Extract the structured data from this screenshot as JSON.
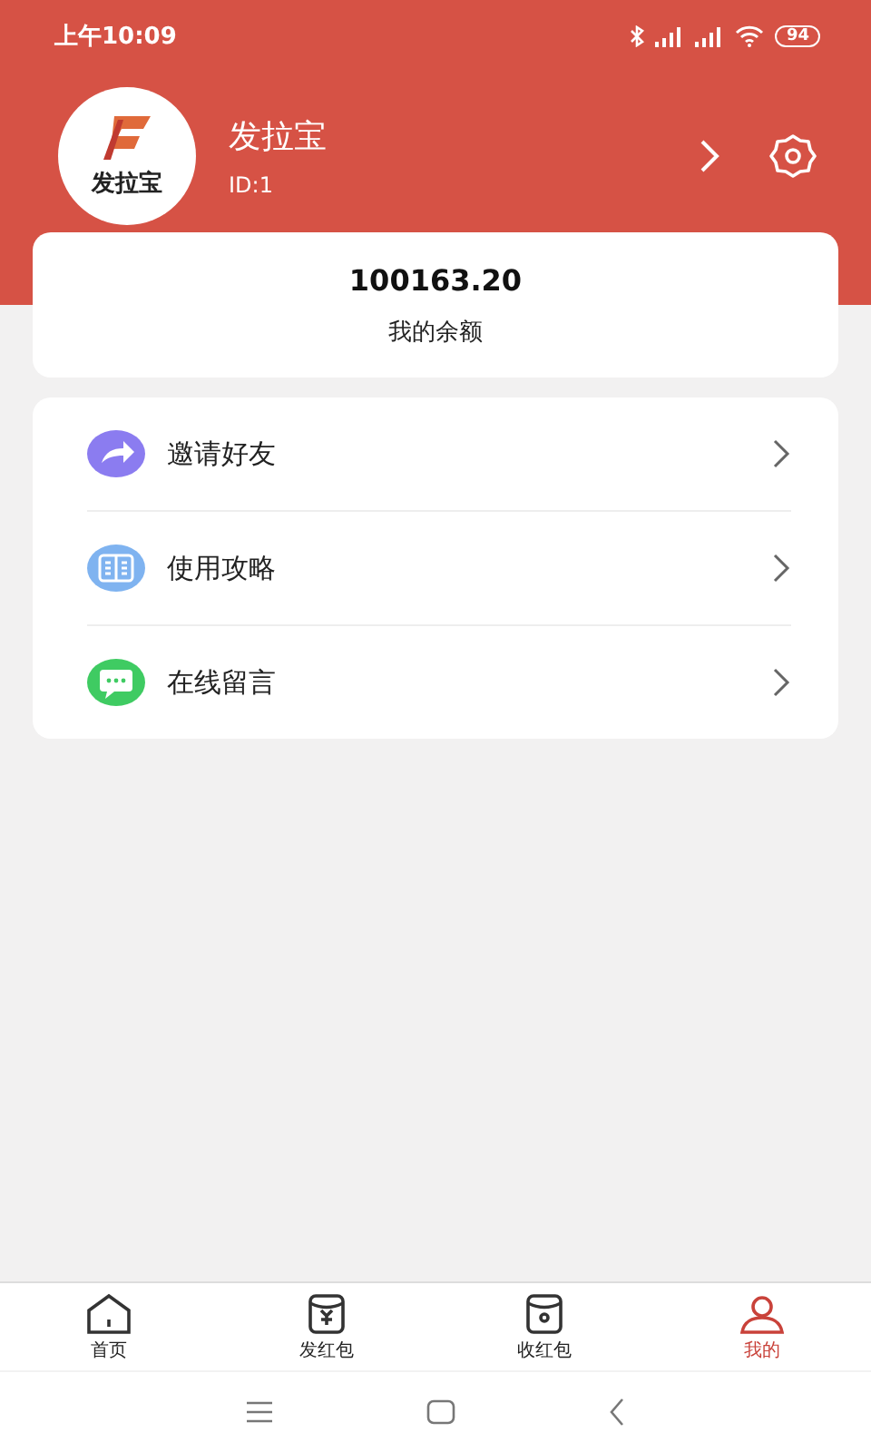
{
  "status_bar": {
    "time": "上午10:09",
    "battery": "94"
  },
  "profile": {
    "logo_text": "发拉宝",
    "name": "发拉宝",
    "id": "ID:1"
  },
  "balance": {
    "amount": "100163.20",
    "label": "我的余额"
  },
  "menu": [
    {
      "kind": "share",
      "label": "邀请好友",
      "color": "#8b7cf0"
    },
    {
      "kind": "guide",
      "label": "使用攻略",
      "color": "#7fb3f0"
    },
    {
      "kind": "message",
      "label": "在线留言",
      "color": "#3fcb62"
    }
  ],
  "tabs": [
    {
      "kind": "home",
      "label": "首页",
      "selected": false
    },
    {
      "kind": "send",
      "label": "发红包",
      "selected": false
    },
    {
      "kind": "receive",
      "label": "收红包",
      "selected": false
    },
    {
      "kind": "me",
      "label": "我的",
      "selected": true
    }
  ]
}
